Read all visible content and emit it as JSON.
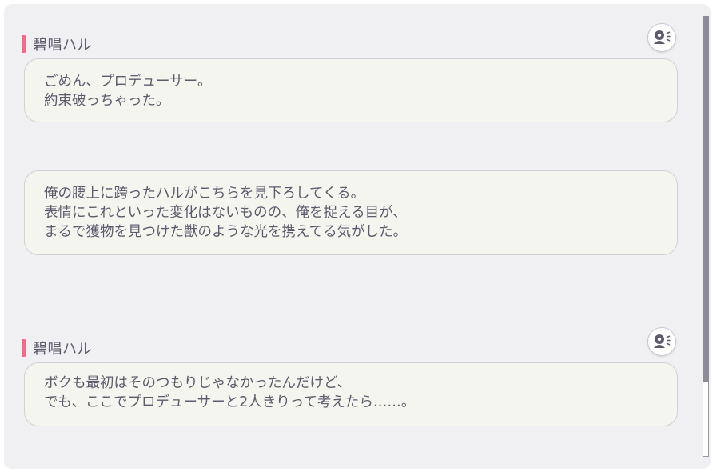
{
  "messages": [
    {
      "speaker": "碧唱ハル",
      "lines": [
        "ごめん、プロデューサー。",
        "約束破っちゃった。"
      ],
      "voice_icon": "voice-play-icon"
    },
    {
      "speaker": "",
      "lines": [
        "俺の腰上に跨ったハルがこちらを見下ろしてくる。",
        "表情にこれといった変化はないものの、俺を捉える目が、",
        "まるで獲物を見つけた獣のような光を携えてる気がした。"
      ]
    },
    {
      "speaker": "碧唱ハル",
      "lines": [
        "ボクも最初はそのつもりじゃなかったんだけど、",
        "でも、ここでプロデューサーと2人きりって考えたら……。"
      ],
      "voice_icon": "voice-play-icon"
    }
  ],
  "colors": {
    "speaker_bar": "#f06a8e",
    "text": "#5e5a6b",
    "panel_bg": "#f0f0f3",
    "bubble_bg": "#f5f5f0",
    "scroll_thumb": "#8d8b96"
  }
}
